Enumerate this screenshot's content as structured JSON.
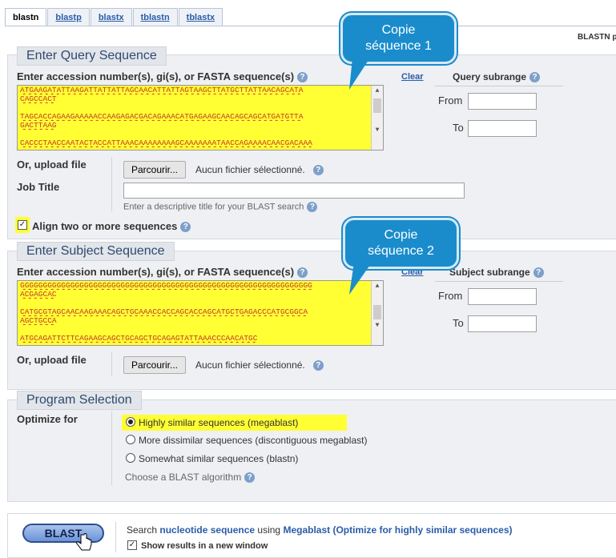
{
  "tabs": [
    "blastn",
    "blastp",
    "blastx",
    "tblastn",
    "tblastx"
  ],
  "program_name": "BLASTN p",
  "query": {
    "legend": "Enter Query Sequence",
    "input_label": "Enter accession number(s), gi(s), or FASTA sequence(s)",
    "clear": "Clear",
    "sequence_lines": [
      "ATGAAGATATTAAGATTATTATTAGCAACATTATTAGTAAGCTTATGCTTATTAACAGCATA",
      "CAGCCACT",
      "",
      "TAGCACCAGAAGAAAAACCAAGAGACGACAGAAACATGAGAAGCAACAGCAGCATGATGTTA",
      "GACTTAAG",
      "",
      "CACCCTAACCAATACTACCATTAAACAAAAAAAAGCAAAAAAATAACCAGAAAACAACGACAAA"
    ],
    "subrange_title": "Query subrange",
    "from_label": "From",
    "to_label": "To",
    "upload_label": "Or, upload file",
    "browse_label": "Parcourir...",
    "no_file": "Aucun fichier sélectionné.",
    "job_title_label": "Job Title",
    "job_title_hint": "Enter a descriptive title for your BLAST search",
    "align_label": "Align two or more sequences",
    "align_checked": true
  },
  "subject": {
    "legend": "Enter Subject Sequence",
    "input_label": "Enter accession number(s), gi(s), or FASTA sequence(s)",
    "clear": "Clear",
    "sequence_lines": [
      "GGGGGGGGGGGGGGGGGGGGGGGGGGGGGGGGGGGGGGGGGGGGGGGGGGGGGGGGGGGGGGGG",
      "ACGAGCAC",
      "",
      "CATGCGTAGCAACAAGAAACAGCTGCAAACCACCAGCACCAGCATGCTGAGACCCATGCGGCA",
      "AGCTGCCA",
      "",
      "ATGCAGATTCTTCAGAAGCAGCTGCAGCTGCAGAGTATTAAACCCAACATGC"
    ],
    "subrange_title": "Subject subrange",
    "from_label": "From",
    "to_label": "To",
    "upload_label": "Or, upload file",
    "browse_label": "Parcourir...",
    "no_file": "Aucun fichier sélectionné."
  },
  "program": {
    "legend": "Program Selection",
    "optimize_label": "Optimize for",
    "options": [
      "Highly similar sequences (megablast)",
      "More dissimilar sequences (discontiguous megablast)",
      "Somewhat similar sequences (blastn)"
    ],
    "selected_index": 0,
    "choose_algorithm": "Choose a BLAST algorithm"
  },
  "callouts": [
    "Copie séquence 1",
    "Copie séquence 2"
  ],
  "bottom": {
    "button": "BLAST",
    "search_prefix": "Search",
    "search_db": "nucleotide sequence",
    "search_using": "using",
    "search_algo": "Megablast (Optimize for highly similar sequences)",
    "new_window": "Show results in a new window"
  },
  "colors": {
    "highlight": "#ffff33",
    "callout": "#1a8ccc",
    "link": "#2a5ca8"
  }
}
